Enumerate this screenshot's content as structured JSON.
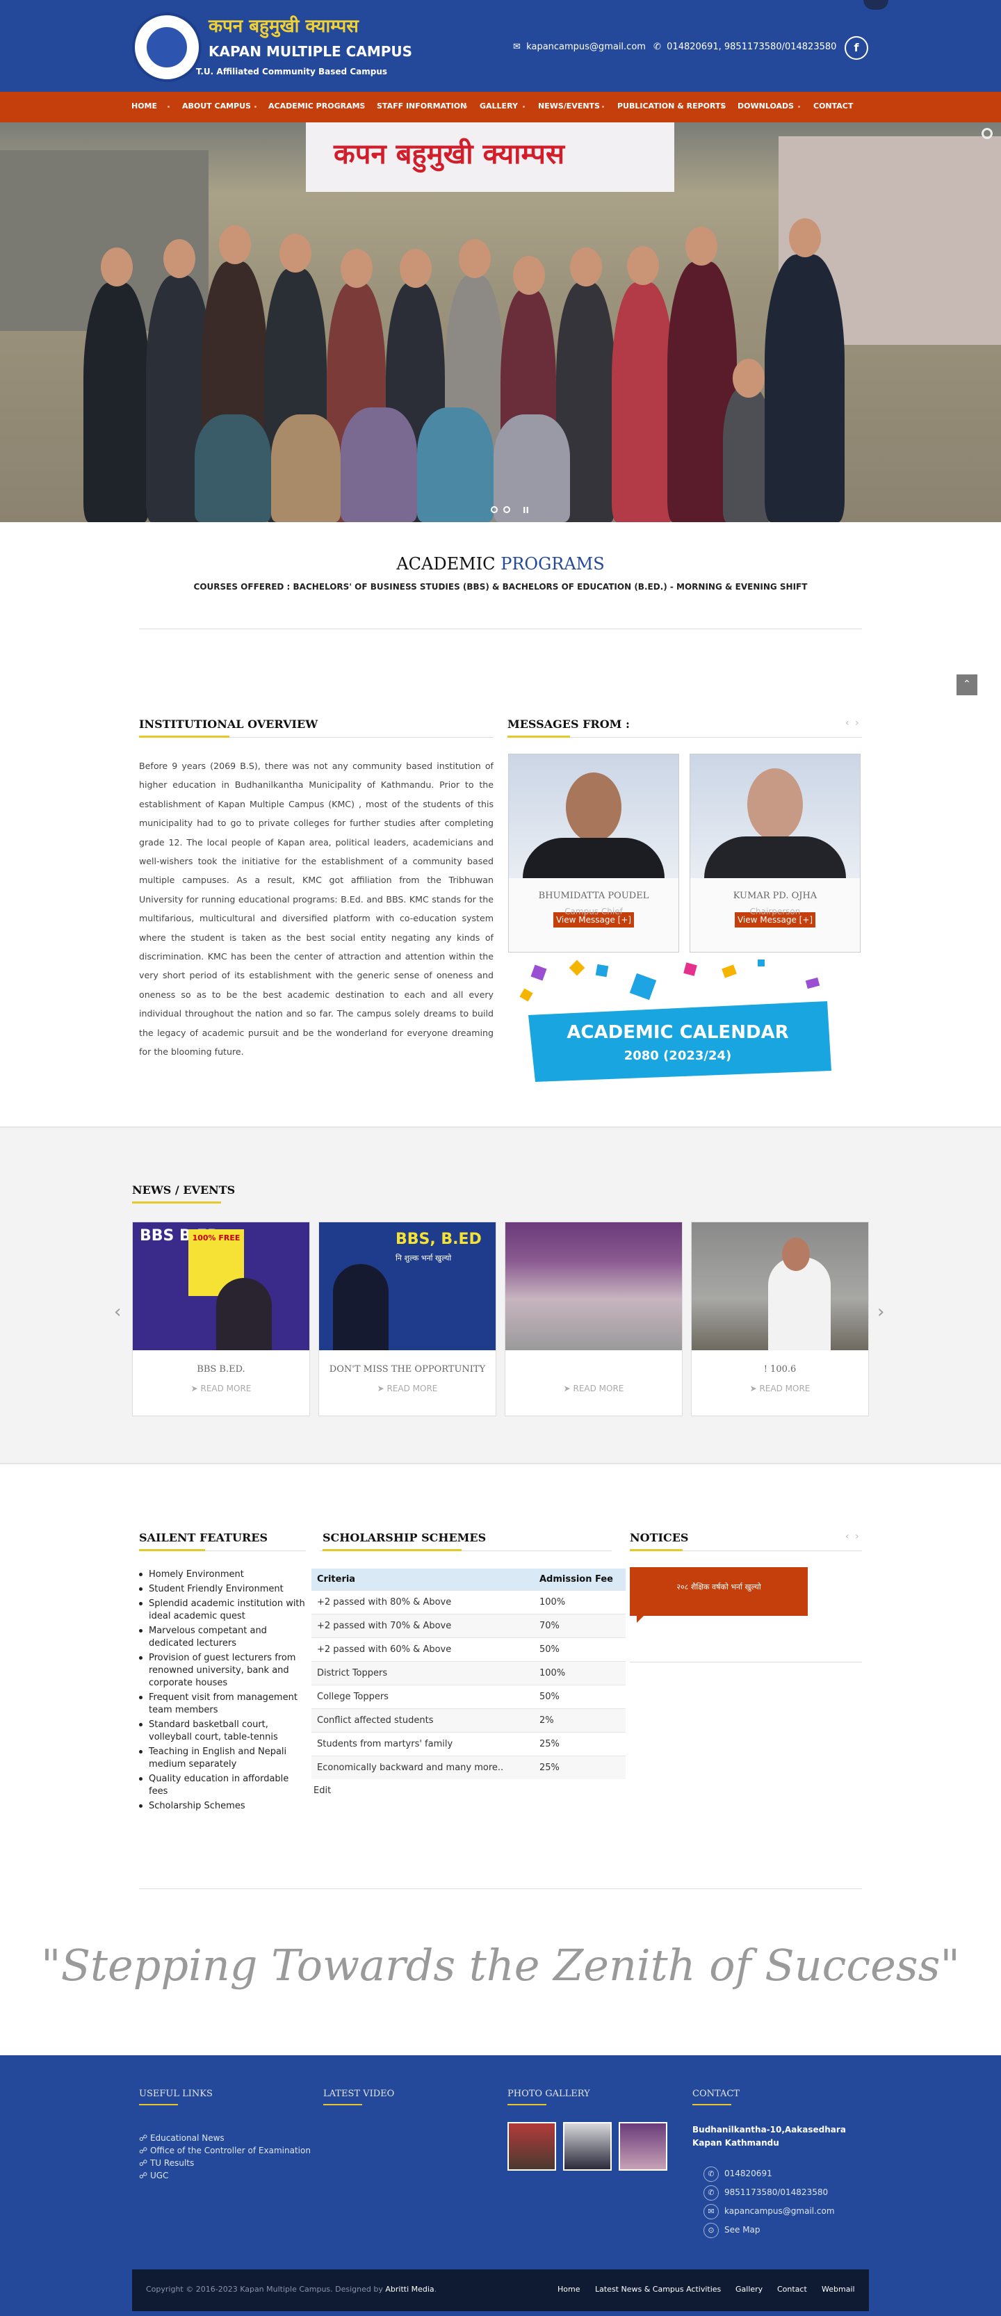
{
  "header": {
    "title_np": "कपन बहुमुखी क्याम्पस",
    "title_en": "KAPAN MULTIPLE CAMPUS",
    "tagline": "T.U. Affiliated Community Based Campus",
    "email": "kapancampus@gmail.com",
    "phone": "014820691, 9851173580/014823580",
    "facebook": "f"
  },
  "nav": [
    "HOME",
    "ABOUT CAMPUS",
    "ACADEMIC PROGRAMS",
    "STAFF INFORMATION",
    "GALLERY",
    "NEWS/EVENTS",
    "PUBLICATION & REPORTS",
    "DOWNLOADS",
    "CONTACT"
  ],
  "hero": {
    "banner_text": "कपन बहुमुखी क्याम्पस"
  },
  "academic": {
    "title_a": "ACADEMIC",
    "title_b": "PROGRAMS",
    "courses": "COURSES OFFERED : BACHELORS' OF BUSINESS STUDIES (BBS) & BACHELORS OF EDUCATION (B.ED.) - MORNING & EVENING SHIFT"
  },
  "overview": {
    "title": "INSTITUTIONAL OVERVIEW",
    "text": "Before 9 years (2069 B.S), there was not any community based institution of higher education in Budhanilkantha Municipality of Kathmandu. Prior to the establishment of Kapan Multiple Campus (KMC) , most of the students of this municipality had to go to private colleges for further studies after completing grade 12. The local people of Kapan area, political leaders, academicians and well-wishers took the initiative for the establishment of a community based multiple campuses. As a result, KMC got affiliation from the Tribhuwan University for running educational programs: B.Ed. and BBS. KMC stands for the multifarious, multicultural and diversified platform with co-education system where the student is taken as the best social entity negating any kinds of discrimination. KMC has been the center of attraction and attention within the very short period of its establishment with the generic sense of oneness and oneness so as to be the best academic destination to each and all every individual throughout the nation and so far. The campus solely dreams to build the legacy of academic pursuit and be the wonderland for everyone dreaming for the blooming future."
  },
  "messages": {
    "title": "MESSAGES FROM :",
    "people": [
      {
        "name": "BHUMIDATTA POUDEL",
        "role": "Campus Chief",
        "button": "View Message [+]"
      },
      {
        "name": "KUMAR PD. OJHA",
        "role": "Chairperson",
        "button": "View Message [+]"
      }
    ]
  },
  "calendar": {
    "title": "ACADEMIC CALENDAR",
    "year": "2080 (2023/24)"
  },
  "news": {
    "title": "NEWS / EVENTS",
    "read_more": "➤ READ MORE",
    "items": [
      {
        "caption": "BBS B.ED.",
        "img_text": "BBS B.ED",
        "img_sub": "100% FREE"
      },
      {
        "caption": "DON'T MISS THE OPPORTUNITY",
        "img_text": "BBS, B.ED",
        "img_sub": "नि शुल्क भर्ना खुल्यो"
      },
      {
        "caption": "",
        "img_text": "",
        "img_sub": ""
      },
      {
        "caption": "! 100.6",
        "img_text": "",
        "img_sub": ""
      }
    ]
  },
  "features": {
    "title": "SAILENT FEATURES",
    "items": [
      "Homely Environment",
      "Student Friendly Environment",
      "Splendid academic institution with ideal academic quest",
      "Marvelous competant and dedicated lecturers",
      "Provision of guest lecturers from renowned university, bank and corporate houses",
      "Frequent visit from management team members",
      "Standard basketball court, volleyball court, table-tennis",
      "Teaching in English and Nepali medium separately",
      "Quality education in affordable fees",
      "Scholarship Schemes"
    ]
  },
  "scholarship": {
    "title": "SCHOLARSHIP SCHEMES",
    "headers": [
      "Criteria",
      "Admission Fee"
    ],
    "rows": [
      [
        "+2 passed with 80% & Above",
        "100%"
      ],
      [
        "+2 passed with 70% & Above",
        "70%"
      ],
      [
        "+2 passed with 60% & Above",
        "50%"
      ],
      [
        "District Toppers",
        "100%"
      ],
      [
        "College Toppers",
        "50%"
      ],
      [
        "Conflict affected students",
        "2%"
      ],
      [
        "Students from martyrs' family",
        "25%"
      ],
      [
        "Economically backward and many more..",
        "25%"
      ]
    ],
    "edit": "Edit"
  },
  "notices": {
    "title": "NOTICES",
    "item": "२०८ शैक्षिक वर्षको भर्ना खुल्यो"
  },
  "quote": "\"Stepping Towards the Zenith of Success\"",
  "footer": {
    "useful_title": "USEFUL LINKS",
    "useful_links": [
      "Educational News",
      "Office of the Controller of Examination",
      "TU Results",
      "UGC"
    ],
    "video_title": "LATEST VIDEO",
    "gallery_title": "PHOTO GALLERY",
    "contact_title": "CONTACT",
    "address": "Budhanilkantha-10,Aakasedhara Kapan Kathmandu",
    "phone1": "014820691",
    "phone2": "9851173580/014823580",
    "email": "kapancampus@gmail.com",
    "map": "See Map"
  },
  "copyright": {
    "text": "Copyright © 2016-2023 Kapan Multiple Campus. Designed by",
    "designer": "Abritti Media",
    "links": [
      "Home",
      "Latest News & Campus Activities",
      "Gallery",
      "Contact",
      "Webmail"
    ]
  },
  "colors": {
    "primary_blue": "#24499a",
    "accent_orange": "#c43f0b",
    "accent_yellow": "#e6c82b"
  }
}
